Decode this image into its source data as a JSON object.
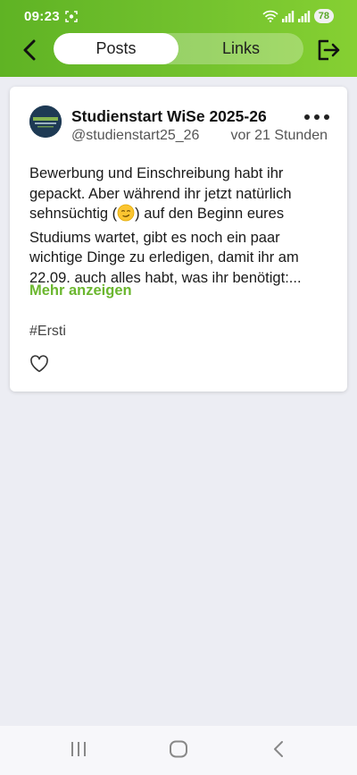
{
  "status_bar": {
    "time": "09:23",
    "battery": "78"
  },
  "tabs": [
    {
      "label": "Posts",
      "active": true
    },
    {
      "label": "Links",
      "active": false
    }
  ],
  "post": {
    "author_name": "Studienstart WiSe 2025-26",
    "handle": "@studienstart25_26",
    "time": "vor 21 Stunden",
    "avatar_text": "STUDIENSTART",
    "text_lines": [
      "Bewerbung und Einschreibung habt ihr",
      "gepackt. Aber während ihr jetzt natürlich",
      "sehnsüchtig (",
      ") auf den Beginn eures",
      "Studiums wartet, gibt es noch ein paar",
      "wichtige Dinge zu erledigen, damit ihr am",
      "22.09. auch alles habt, was ihr benötigt:..."
    ],
    "show_more": "Mehr anzeigen",
    "hashtag": "#Ersti"
  },
  "colors": {
    "header_start": "#5fb324",
    "header_end": "#86d032",
    "accent": "#6bb72f",
    "background": "#ecedf3"
  },
  "icons": [
    "back-arrow-icon",
    "logout-icon",
    "more-dots-icon",
    "heart-icon",
    "recent-apps-icon",
    "home-icon",
    "back-icon"
  ]
}
